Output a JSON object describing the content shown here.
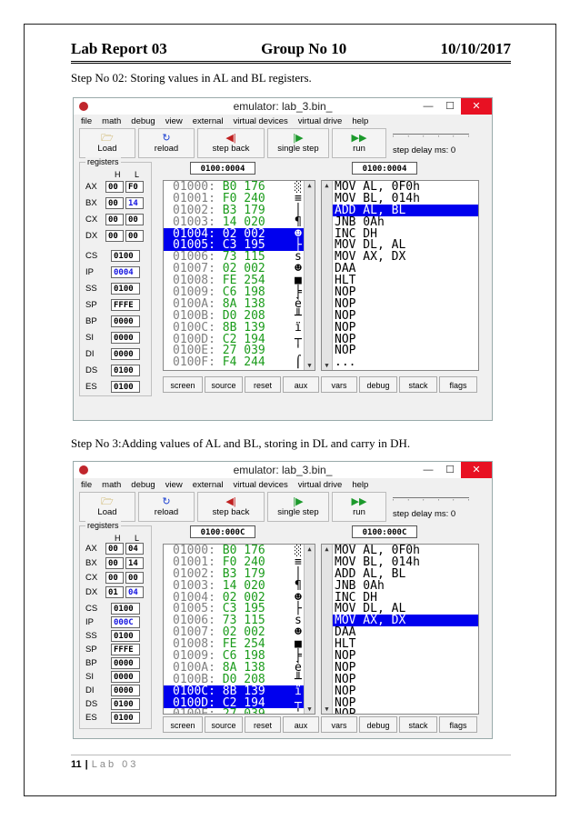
{
  "header": {
    "title": "Lab Report 03",
    "group": "Group No 10",
    "date": "10/10/2017"
  },
  "step2": "Step No 02: Storing values in AL and BL registers.",
  "step3": "Step No 3:Adding values of AL and BL, storing in DL and carry in DH.",
  "footer": {
    "page": "11",
    "sep": "|",
    "label": "Lab 03"
  },
  "colors": {
    "selection": "#0000ee",
    "blue_value": "#1414e0",
    "byte_green": "#1a9b1a",
    "address_gray": "#808080",
    "close_red": "#e81123"
  },
  "emulator_common": {
    "title": "emulator: lab_3.bin_",
    "min": "—",
    "max": "☐",
    "close": "✕",
    "menu": [
      "file",
      "math",
      "debug",
      "view",
      "external",
      "virtual devices",
      "virtual drive",
      "help"
    ],
    "toolbar": {
      "load": "Load",
      "reload": "reload",
      "step_back": "step back",
      "single_step": "single step",
      "run": "run",
      "step_delay": "step delay ms: 0"
    },
    "regs_title": "registers",
    "h": "H",
    "l": "L",
    "bottom": [
      "screen",
      "source",
      "reset",
      "aux",
      "vars",
      "debug",
      "stack",
      "flags"
    ],
    "reg_names": {
      "ax": "AX",
      "bx": "BX",
      "cx": "CX",
      "dx": "DX",
      "cs": "CS",
      "ip": "IP",
      "ss": "SS",
      "sp": "SP",
      "bp": "BP",
      "si": "SI",
      "di": "DI",
      "ds": "DS",
      "es": "ES"
    },
    "memory": [
      {
        "addr": "01000:",
        "b": "B0",
        "d": "176",
        "c": "░"
      },
      {
        "addr": "01001:",
        "b": "F0",
        "d": "240",
        "c": "≡"
      },
      {
        "addr": "01002:",
        "b": "B3",
        "d": "179",
        "c": "│"
      },
      {
        "addr": "01003:",
        "b": "14",
        "d": "020",
        "c": "¶"
      },
      {
        "addr": "01004:",
        "b": "02",
        "d": "002",
        "c": "☻"
      },
      {
        "addr": "01005:",
        "b": "C3",
        "d": "195",
        "c": "├"
      },
      {
        "addr": "01006:",
        "b": "73",
        "d": "115",
        "c": "s"
      },
      {
        "addr": "01007:",
        "b": "02",
        "d": "002",
        "c": "☻"
      },
      {
        "addr": "01008:",
        "b": "FE",
        "d": "254",
        "c": "■"
      },
      {
        "addr": "01009:",
        "b": "C6",
        "d": "198",
        "c": "╞"
      },
      {
        "addr": "0100A:",
        "b": "8A",
        "d": "138",
        "c": "è"
      },
      {
        "addr": "0100B:",
        "b": "D0",
        "d": "208",
        "c": "╨"
      },
      {
        "addr": "0100C:",
        "b": "8B",
        "d": "139",
        "c": "ï"
      },
      {
        "addr": "0100D:",
        "b": "C2",
        "d": "194",
        "c": "┬"
      },
      {
        "addr": "0100E:",
        "b": "27",
        "d": "039",
        "c": "'"
      },
      {
        "addr": "0100F:",
        "b": "F4",
        "d": "244",
        "c": "⌠"
      }
    ],
    "disasm": [
      "MOV AL, 0F0h",
      "MOV BL, 014h",
      "ADD AL, BL",
      "JNB 0Ah",
      "INC DH",
      "MOV DL, AL",
      "MOV AX, DX",
      "DAA",
      "HLT",
      "NOP",
      "NOP",
      "NOP",
      "NOP",
      "NOP",
      "NOP",
      "..."
    ]
  },
  "emu1": {
    "addr1": "0100:0004",
    "addr2": "0100:0004",
    "regs": {
      "ax_h": "00",
      "ax_l": "F0",
      "bx_h": "00",
      "bx_l": "14",
      "cx_h": "00",
      "cx_l": "00",
      "dx_h": "00",
      "dx_l": "00",
      "cs": "0100",
      "ip": "0004",
      "ss": "0100",
      "sp": "FFFE",
      "bp": "0000",
      "si": "0000",
      "di": "0000",
      "ds": "0100",
      "es": "0100"
    },
    "mem_selected": [
      4,
      5
    ],
    "dis_selected": 2
  },
  "emu2": {
    "addr1": "0100:000C",
    "addr2": "0100:000C",
    "regs": {
      "ax_h": "00",
      "ax_l": "04",
      "bx_h": "00",
      "bx_l": "14",
      "cx_h": "00",
      "cx_l": "00",
      "dx_h": "01",
      "dx_l": "04",
      "cs": "0100",
      "ip": "000C",
      "ss": "0100",
      "sp": "FFFE",
      "bp": "0000",
      "si": "0000",
      "di": "0000",
      "ds": "0100",
      "es": "0100"
    },
    "mem_selected": [
      12,
      13
    ],
    "dis_selected": 6
  }
}
